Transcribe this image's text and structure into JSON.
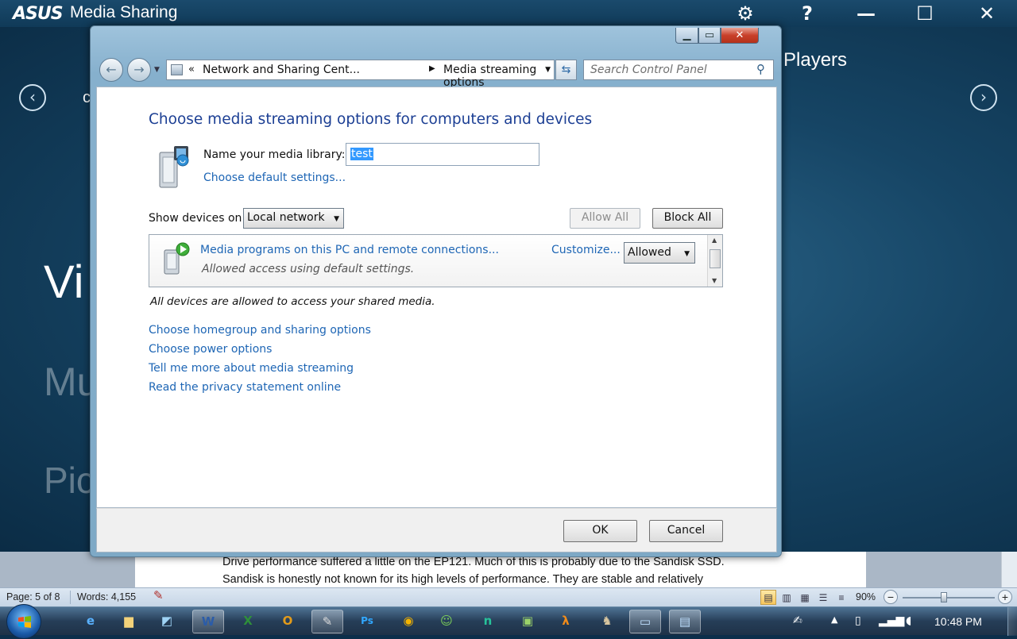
{
  "asus_app": {
    "logo": "/ISUS",
    "title": "Media Sharing",
    "controls": {
      "settings": "⚙",
      "help": "?",
      "minimize": "—",
      "maximize": "☐",
      "close": "✕"
    },
    "partial_heading": "Players",
    "partial_c": "c",
    "partial_video": "Vi",
    "partial_music": "Mu",
    "partial_pictures": "Pic"
  },
  "dialog": {
    "address": {
      "prefix": "«",
      "crumb_parent": "Network and Sharing Cent...",
      "crumb_separator": "▶",
      "crumb_current": "Media streaming options"
    },
    "search_placeholder": "Search Control Panel",
    "page_title": "Choose media streaming options for computers and devices",
    "library_label": "Name your media library:",
    "library_name_value": "test",
    "default_settings_link": "Choose default settings...",
    "show_devices_label": "Show devices on:",
    "show_devices_selected": "Local network",
    "allow_all": "Allow All",
    "block_all": "Block All",
    "device": {
      "name": "Media programs on this PC and remote connections...",
      "status": "Allowed access using default settings.",
      "customize": "Customize...",
      "access": "Allowed"
    },
    "all_allowed_text": "All devices are allowed to access your shared media.",
    "links": [
      "Choose homegroup and sharing options",
      "Choose power options",
      "Tell me more about media streaming",
      "Read the privacy statement online"
    ],
    "ok": "OK",
    "cancel": "Cancel"
  },
  "word": {
    "line1": "Drive performance suffered a little on the EP121. Much of this is probably due to the Sandisk SSD.",
    "line2": "Sandisk is honestly not known for its high levels of performance. They are stable and relatively",
    "status_page": "Page: 5 of 8",
    "status_words": "Words: 4,155",
    "zoom": "90%",
    "zoom_fraction": 0.45
  },
  "taskbar": {
    "time": "10:48 PM",
    "items": [
      "ie-icon",
      "explorer-icon",
      "notes-icon",
      "W",
      "X",
      "O",
      "paint-icon",
      "Ps",
      "chrome-icon",
      "people-icon",
      "n",
      "photo-icon",
      "halflife-icon",
      "puppet-icon",
      "media-icon",
      "network-icon"
    ]
  },
  "colors": {
    "link": "#1e66b5",
    "title": "#1c3f94",
    "selection": "#3399ff"
  }
}
